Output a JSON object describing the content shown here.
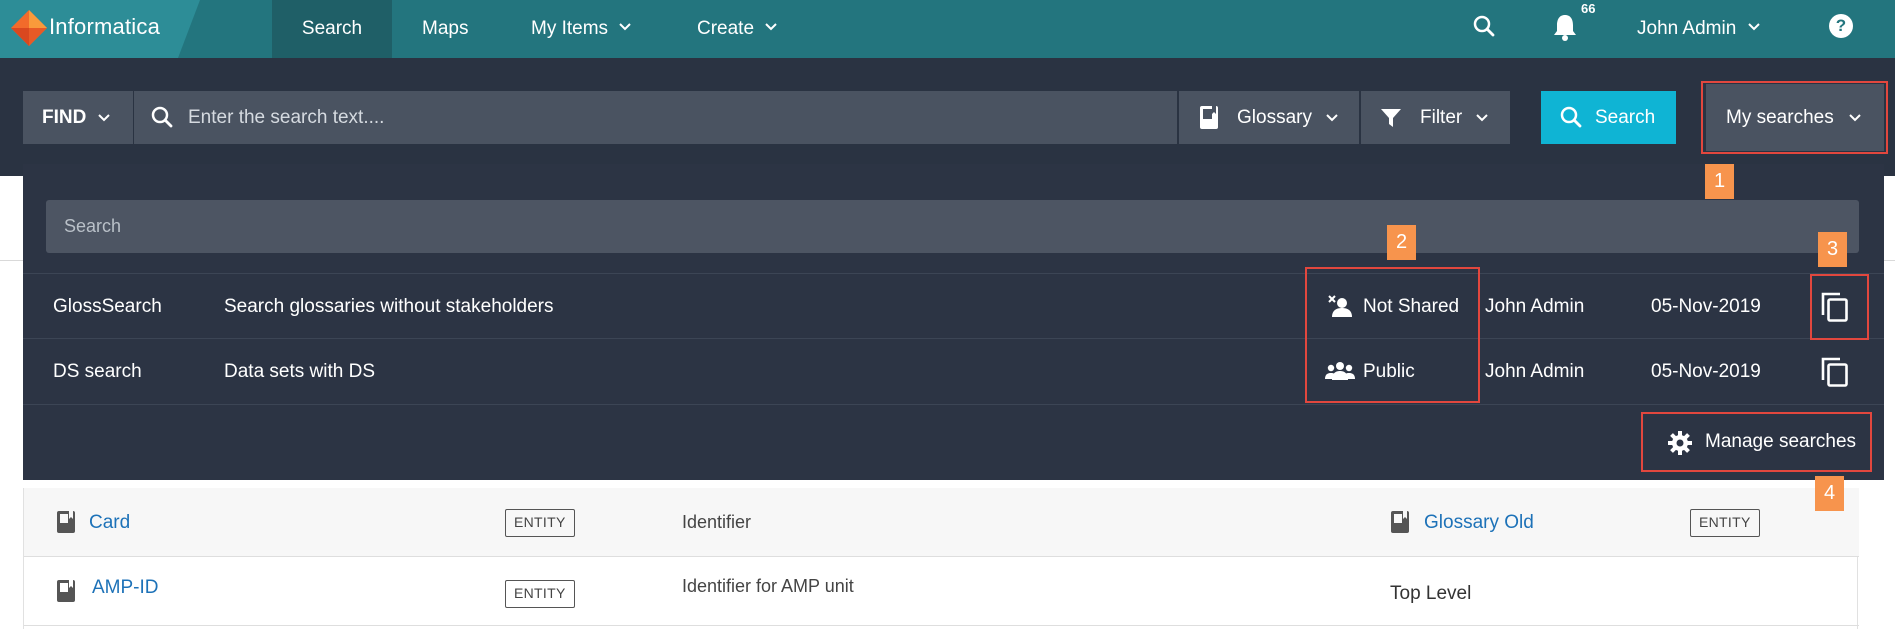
{
  "topnav": {
    "brand": "Informatica",
    "items": [
      {
        "label": "Search"
      },
      {
        "label": "Maps"
      },
      {
        "label": "My Items"
      },
      {
        "label": "Create"
      }
    ],
    "notification_count": "66",
    "user": "John Admin",
    "help_label": "?"
  },
  "searchbar": {
    "find_label": "FIND",
    "placeholder": "Enter the search text....",
    "asset_type": "Glossary",
    "filter_label": "Filter",
    "search_button": "Search",
    "my_searches": "My searches"
  },
  "dropdown": {
    "search_placeholder": "Search",
    "rows": [
      {
        "name": "GlossSearch",
        "description": "Search glossaries without stakeholders",
        "sharing": "Not Shared",
        "owner": "John Admin",
        "date": "05-Nov-2019"
      },
      {
        "name": "DS search",
        "description": "Data sets with DS",
        "sharing": "Public",
        "owner": "John Admin",
        "date": "05-Nov-2019"
      }
    ],
    "manage_label": "Manage searches"
  },
  "callouts": [
    "1",
    "2",
    "3",
    "4"
  ],
  "results": [
    {
      "name": "Card",
      "type": "ENTITY",
      "description": "Identifier",
      "parent": "Glossary Old",
      "parent_type": "ENTITY"
    },
    {
      "name": "AMP-ID",
      "type": "ENTITY",
      "description": "Identifier for AMP unit",
      "parent": "Top Level"
    }
  ],
  "colors": {
    "nav_bg": "#23757e",
    "band_bg": "#2a3342",
    "search_button": "#0fb4d4",
    "callout": "#f7944d",
    "annotation_border": "#e2473e",
    "link": "#1d72b8"
  }
}
